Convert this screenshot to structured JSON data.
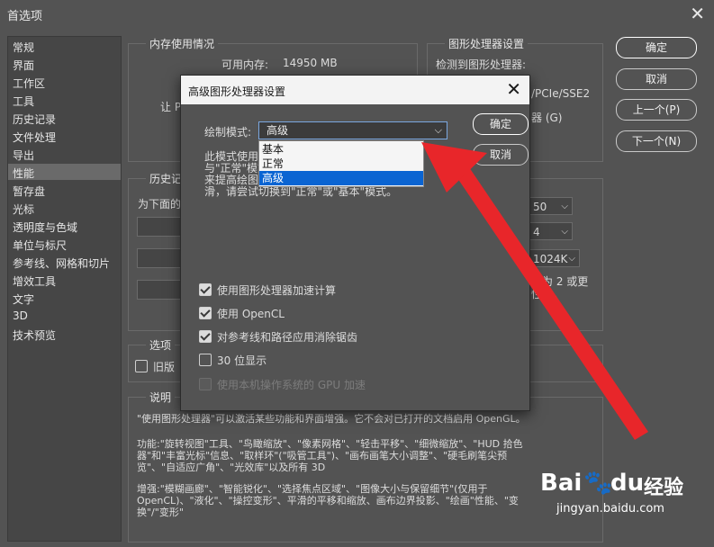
{
  "window": {
    "title": "首选项",
    "close_glyph": "✕"
  },
  "sidebar": {
    "items": [
      "常规",
      "界面",
      "工作区",
      "工具",
      "历史记录",
      "文件处理",
      "导出",
      "性能",
      "暂存盘",
      "光标",
      "透明度与色域",
      "单位与标尺",
      "参考线、网格和切片",
      "增效工具",
      "文字",
      "3D",
      "技术预览"
    ],
    "selected_index": 7
  },
  "memory": {
    "group_label": "内存使用情况",
    "available_label": "可用内存:",
    "available_value": "14950 MB",
    "let_prefix": "让 P"
  },
  "gpu": {
    "group_label": "图形处理器设置",
    "detected_label": "检测到图形处理器:",
    "pcie_text": "/PCIe/SSE2",
    "gpu_suffix": "器 (G)"
  },
  "history": {
    "group_label": "历史记",
    "desc_prefix": "为下面的",
    "sel1": "50",
    "sel2": "4",
    "sel3": "1024K",
    "note1": "置为 2 或更",
    "note2": "性能。"
  },
  "options": {
    "group_label": "选项",
    "legacy_label": "旧版"
  },
  "description": {
    "group_label": "说明",
    "p1": "\"使用图形处理器\"可以激活某些功能和界面增强。它不会对已打开的文档启用 OpenGL。",
    "p2a": "功能:\"旋转视图\"工具、\"鸟瞰缩放\"、\"像素网格\"、\"轻击平移\"、\"细微缩放\"、\"HUD 拾色",
    "p2b": "器\"和\"丰富光标\"信息、\"取样环\"(\"吸管工具\")、\"画布画笔大小调整\"、\"硬毛刷笔尖预",
    "p2c": "览\"、\"自适应广角\"、\"光效库\"以及所有 3D",
    "p3a": "增强:\"模糊画廊\"、\"智能锐化\"、\"选择焦点区域\"、\"图像大小与保留细节\"(仅用于",
    "p3b": "OpenCL)、\"液化\"、\"操控变形\"、平滑的平移和缩放、画布边界投影、\"绘画\"性能、\"变",
    "p3c": "换\"/\"变形\""
  },
  "buttons": {
    "ok": "确定",
    "cancel": "取消",
    "prev": "上一个(P)",
    "next": "下一个(N)"
  },
  "modal": {
    "title": "高级图形处理器设置",
    "close_glyph": "✕",
    "draw_mode_label": "绘制模式:",
    "draw_mode_value": "高级",
    "options": [
      "基本",
      "正常",
      "高级"
    ],
    "highlighted_index": 2,
    "desc_line1": "此模式使用图",
    "desc_line2": "与\"正常\"模式",
    "desc_line3": "来提高绘图性",
    "desc_line4": "滑，请尝试切换到\"正常\"或\"基本\"模式。",
    "ok": "确定",
    "cancel": "取消",
    "checkboxes": [
      {
        "label": "使用图形处理器加速计算",
        "checked": true,
        "disabled": false
      },
      {
        "label": "使用 OpenCL",
        "checked": true,
        "disabled": false
      },
      {
        "label": "对参考线和路径应用消除锯齿",
        "checked": true,
        "disabled": false
      },
      {
        "label": "30 位显示",
        "checked": false,
        "disabled": false
      },
      {
        "label": "使用本机操作系统的 GPU 加速",
        "checked": false,
        "disabled": true
      }
    ]
  },
  "annotation": {
    "arrow_color": "#e8262a"
  },
  "watermark": {
    "brand_prefix": "Bai",
    "brand_suffix": "du",
    "brand_cn": "经验",
    "url": "jingyan.baidu.com"
  },
  "colors": {
    "panel_bg": "#535353",
    "highlight": "#0a64d2",
    "arrow": "#e8262a"
  }
}
